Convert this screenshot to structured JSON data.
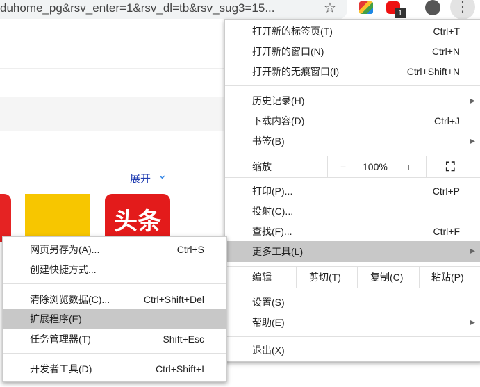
{
  "toolbar": {
    "url": "duhome_pg&rsv_enter=1&rsv_dl=tb&rsv_sug3=15...",
    "extension_badge": "1"
  },
  "page": {
    "expand_link": "展开",
    "toutiao_tile": "头条"
  },
  "main_menu": {
    "new_tab": {
      "label": "打开新的标签页(T)",
      "shortcut": "Ctrl+T"
    },
    "new_window": {
      "label": "打开新的窗口(N)",
      "shortcut": "Ctrl+N"
    },
    "incognito": {
      "label": "打开新的无痕窗口(I)",
      "shortcut": "Ctrl+Shift+N"
    },
    "history": {
      "label": "历史记录(H)"
    },
    "downloads": {
      "label": "下载内容(D)",
      "shortcut": "Ctrl+J"
    },
    "bookmarks": {
      "label": "书签(B)"
    },
    "zoom": {
      "label": "缩放",
      "minus": "−",
      "value": "100%",
      "plus": "+"
    },
    "print": {
      "label": "打印(P)...",
      "shortcut": "Ctrl+P"
    },
    "cast": {
      "label": "投射(C)..."
    },
    "find": {
      "label": "查找(F)...",
      "shortcut": "Ctrl+F"
    },
    "more_tools": {
      "label": "更多工具(L)"
    },
    "edit": {
      "label": "编辑",
      "cut": "剪切(T)",
      "copy": "复制(C)",
      "paste": "粘贴(P)"
    },
    "settings": {
      "label": "设置(S)"
    },
    "help": {
      "label": "帮助(E)"
    },
    "exit": {
      "label": "退出(X)"
    }
  },
  "sub_menu": {
    "save_page": {
      "label": "网页另存为(A)...",
      "shortcut": "Ctrl+S"
    },
    "create_shortcut": {
      "label": "创建快捷方式..."
    },
    "clear_data": {
      "label": "清除浏览数据(C)...",
      "shortcut": "Ctrl+Shift+Del"
    },
    "extensions": {
      "label": "扩展程序(E)"
    },
    "task_manager": {
      "label": "任务管理器(T)",
      "shortcut": "Shift+Esc"
    },
    "dev_tools": {
      "label": "开发者工具(D)",
      "shortcut": "Ctrl+Shift+I"
    }
  }
}
